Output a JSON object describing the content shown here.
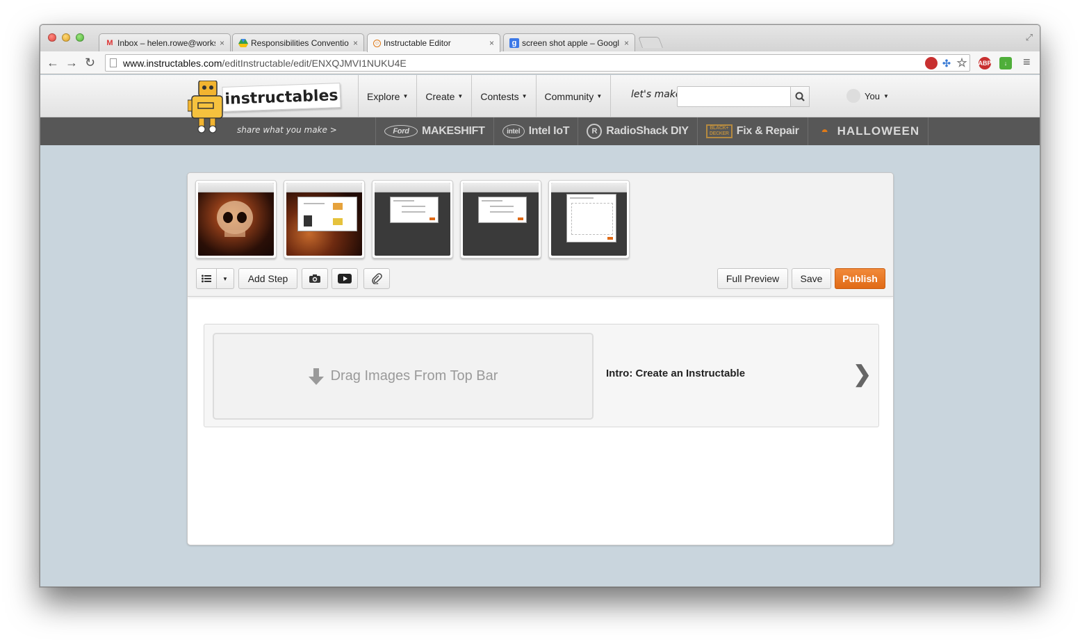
{
  "browser": {
    "tabs": [
      {
        "title": "Inbox – helen.rowe@worksi",
        "favicon": "gmail-icon"
      },
      {
        "title": "Responsibilities Conventio",
        "favicon": "google-drive-icon"
      },
      {
        "title": "Instructable Editor",
        "favicon": "instructables-icon"
      },
      {
        "title": "screen shot apple – Googl",
        "favicon": "google-search-icon"
      }
    ],
    "close_glyph": "×",
    "url_host": "www.instructables.com",
    "url_path": "/editInstructable/edit/ENXQJMVI1NUKU4E"
  },
  "site": {
    "brand": "instructables",
    "tagline": "share what you make >",
    "nav": [
      {
        "label": "Explore"
      },
      {
        "label": "Create"
      },
      {
        "label": "Contests"
      },
      {
        "label": "Community"
      }
    ],
    "search_label": "let's make",
    "search_placeholder": "",
    "user_label": "You",
    "channels": [
      {
        "label": "MAKESHIFT",
        "logo_text": "Ford"
      },
      {
        "label": "Intel IoT",
        "logo_text": "intel"
      },
      {
        "label": "RadioShack DIY",
        "logo_text": "R"
      },
      {
        "label": "Fix & Repair",
        "logo_text": "BLACK+ DECKER"
      },
      {
        "label": "HALLOWEEN",
        "logo_text": ""
      }
    ]
  },
  "editor": {
    "thumbnails": [
      {
        "kind": "skull"
      },
      {
        "kind": "skull-dialog"
      },
      {
        "kind": "dialog"
      },
      {
        "kind": "dialog"
      },
      {
        "kind": "dropzone-dialog"
      }
    ],
    "toolbar": {
      "add_step": "Add Step",
      "full_preview": "Full Preview",
      "save": "Save",
      "publish": "Publish"
    },
    "step": {
      "dropzone_text": "Drag Images From Top Bar",
      "title": "Intro: Create an Instructable"
    }
  },
  "colors": {
    "publish": "#e06a16",
    "page_background": "#c9d5dd",
    "site_bar": "#575757"
  }
}
